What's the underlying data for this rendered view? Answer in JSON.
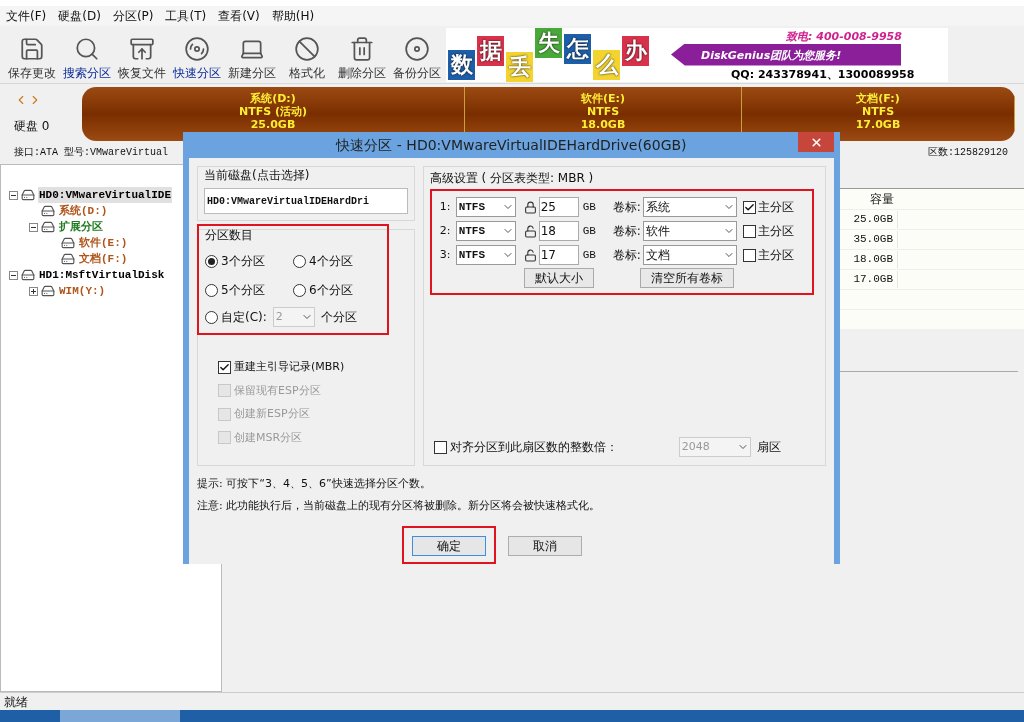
{
  "menu": [
    "文件(F)",
    "硬盘(D)",
    "分区(P)",
    "工具(T)",
    "查看(V)",
    "帮助(H)"
  ],
  "toolbar": [
    {
      "label": "保存更改",
      "active": false
    },
    {
      "label": "搜索分区",
      "active": true
    },
    {
      "label": "恢复文件",
      "active": false
    },
    {
      "label": "快速分区",
      "active": true
    },
    {
      "label": "新建分区",
      "active": false
    },
    {
      "label": "格式化",
      "active": false
    },
    {
      "label": "删除分区",
      "active": false
    },
    {
      "label": "备份分区",
      "active": false
    }
  ],
  "banner": {
    "tiles": [
      {
        "text": "数",
        "color": "#1d5ea8"
      },
      {
        "text": "据",
        "color": "#d8324a"
      },
      {
        "text": "丢",
        "color": "#f2d330"
      },
      {
        "text": "失",
        "color": "#49a83a"
      },
      {
        "text": "怎",
        "color": "#1d5ea8"
      },
      {
        "text": "么",
        "color": "#f2d330"
      },
      {
        "text": "办",
        "color": "#d8324a"
      }
    ],
    "slogan": "DiskGenius团队为您服务!",
    "phone_label": "致电:",
    "phone": "400-008-9958",
    "qq": "QQ: 243378941、1300089958"
  },
  "disk": {
    "label": "硬盘 0",
    "partitions": [
      {
        "name": "系统(D:)",
        "fs": "NTFS (活动)",
        "size": "25.0GB"
      },
      {
        "name": "软件(E:)",
        "fs": "NTFS",
        "size": "18.0GB"
      },
      {
        "name": "文档(F:)",
        "fs": "NTFS",
        "size": "17.0GB"
      }
    ],
    "info": [
      "接口:ATA",
      "型号:VMwareVirtual"
    ],
    "info_right": "区数:125829120"
  },
  "tree": [
    {
      "label": "HD0:VMwareVirtualIDE",
      "kind": "disk",
      "selected": true,
      "expanded": true,
      "children": [
        {
          "label": "系统(D:)",
          "kind": "primary",
          "selected": false
        },
        {
          "label": "扩展分区",
          "kind": "extended",
          "selected": false,
          "expanded": true,
          "children": [
            {
              "label": "软件(E:)",
              "kind": "primary",
              "selected": false
            },
            {
              "label": "文档(F:)",
              "kind": "primary",
              "selected": false
            }
          ]
        }
      ]
    },
    {
      "label": "HD1:MsftVirtualDisk",
      "kind": "disk",
      "selected": false,
      "expanded": true,
      "children": [
        {
          "label": "WIM(Y:)",
          "kind": "primary",
          "selected": false,
          "expanded": false
        }
      ]
    }
  ],
  "table": {
    "column": "容量",
    "rows": [
      "25.0GB",
      "35.0GB",
      "18.0GB",
      "17.0GB"
    ]
  },
  "status": "就绪",
  "dialog": {
    "title": "快速分区 - HD0:VMwareVirtualIDEHardDrive(60GB)",
    "current_disk": {
      "label": "当前磁盘(点击选择)",
      "value": "HD0:VMwareVirtualIDEHardDri"
    },
    "count": {
      "label": "分区数目",
      "options": [
        {
          "label": "3个分区",
          "selected": true
        },
        {
          "label": "4个分区",
          "selected": false
        },
        {
          "label": "5个分区",
          "selected": false
        },
        {
          "label": "6个分区",
          "selected": false
        },
        {
          "label": "自定(C):",
          "selected": false
        }
      ],
      "custom_value": "2",
      "custom_disabled": true,
      "custom_suffix": "个分区"
    },
    "options": [
      {
        "label": "重建主引导记录(MBR)",
        "checked": true,
        "disabled": false
      },
      {
        "label": "保留现有ESP分区",
        "checked": false,
        "disabled": true
      },
      {
        "label": "创建新ESP分区",
        "checked": false,
        "disabled": true
      },
      {
        "label": "创建MSR分区",
        "checked": false,
        "disabled": true
      }
    ],
    "advanced": {
      "title": "高级设置 ( 分区表类型: MBR )",
      "rows": [
        {
          "index": "1:",
          "fs": "NTFS",
          "locked": true,
          "size": "25",
          "unit": "GB",
          "caption": "卷标:",
          "volume": "系统",
          "primary": true,
          "primary_label": "主分区"
        },
        {
          "index": "2:",
          "fs": "NTFS",
          "locked": false,
          "size": "18",
          "unit": "GB",
          "caption": "卷标:",
          "volume": "软件",
          "primary": false,
          "primary_label": "主分区"
        },
        {
          "index": "3:",
          "fs": "NTFS",
          "locked": false,
          "size": "17",
          "unit": "GB",
          "caption": "卷标:",
          "volume": "文档",
          "primary": false,
          "primary_label": "主分区"
        }
      ],
      "buttons": [
        "默认大小",
        "清空所有卷标"
      ]
    },
    "align": {
      "checked": false,
      "label": "对齐分区到此扇区数的整数倍：",
      "value": "2048",
      "disabled": true,
      "unit": "扇区"
    },
    "hints": [
      "提示: 可按下“3、4、5、6”快速选择分区个数。",
      "注意: 此功能执行后，当前磁盘上的现有分区将被删除。新分区将会被快速格式化。"
    ],
    "buttons": [
      {
        "label": "确定",
        "default": true
      },
      {
        "label": "取消",
        "default": false
      }
    ]
  }
}
